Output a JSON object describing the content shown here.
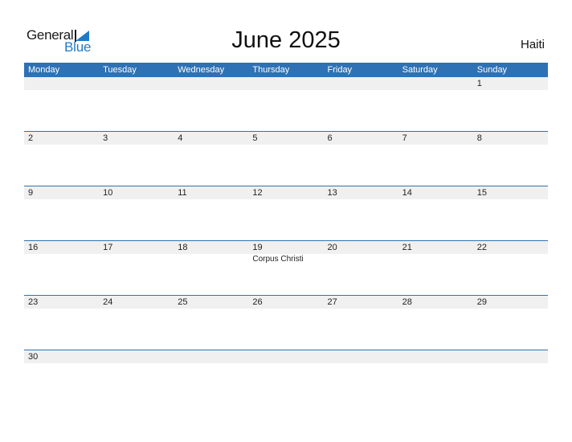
{
  "brand": {
    "name_part1": "General",
    "name_part2": "Blue",
    "accent": "#2e71b4"
  },
  "header": {
    "title": "June 2025",
    "country": "Haiti"
  },
  "weekdays": [
    "Monday",
    "Tuesday",
    "Wednesday",
    "Thursday",
    "Friday",
    "Saturday",
    "Sunday"
  ],
  "weeks": [
    {
      "days": [
        {
          "num": ""
        },
        {
          "num": ""
        },
        {
          "num": ""
        },
        {
          "num": ""
        },
        {
          "num": ""
        },
        {
          "num": ""
        },
        {
          "num": "1"
        }
      ]
    },
    {
      "days": [
        {
          "num": "2"
        },
        {
          "num": "3"
        },
        {
          "num": "4"
        },
        {
          "num": "5"
        },
        {
          "num": "6"
        },
        {
          "num": "7"
        },
        {
          "num": "8"
        }
      ]
    },
    {
      "days": [
        {
          "num": "9"
        },
        {
          "num": "10"
        },
        {
          "num": "11"
        },
        {
          "num": "12"
        },
        {
          "num": "13"
        },
        {
          "num": "14"
        },
        {
          "num": "15"
        }
      ]
    },
    {
      "days": [
        {
          "num": "16"
        },
        {
          "num": "17"
        },
        {
          "num": "18"
        },
        {
          "num": "19",
          "event": "Corpus Christi"
        },
        {
          "num": "20"
        },
        {
          "num": "21"
        },
        {
          "num": "22"
        }
      ]
    },
    {
      "days": [
        {
          "num": "23"
        },
        {
          "num": "24"
        },
        {
          "num": "25"
        },
        {
          "num": "26"
        },
        {
          "num": "27"
        },
        {
          "num": "28"
        },
        {
          "num": "29"
        }
      ]
    },
    {
      "days": [
        {
          "num": "30"
        },
        {
          "num": ""
        },
        {
          "num": ""
        },
        {
          "num": ""
        },
        {
          "num": ""
        },
        {
          "num": ""
        },
        {
          "num": ""
        }
      ]
    }
  ]
}
